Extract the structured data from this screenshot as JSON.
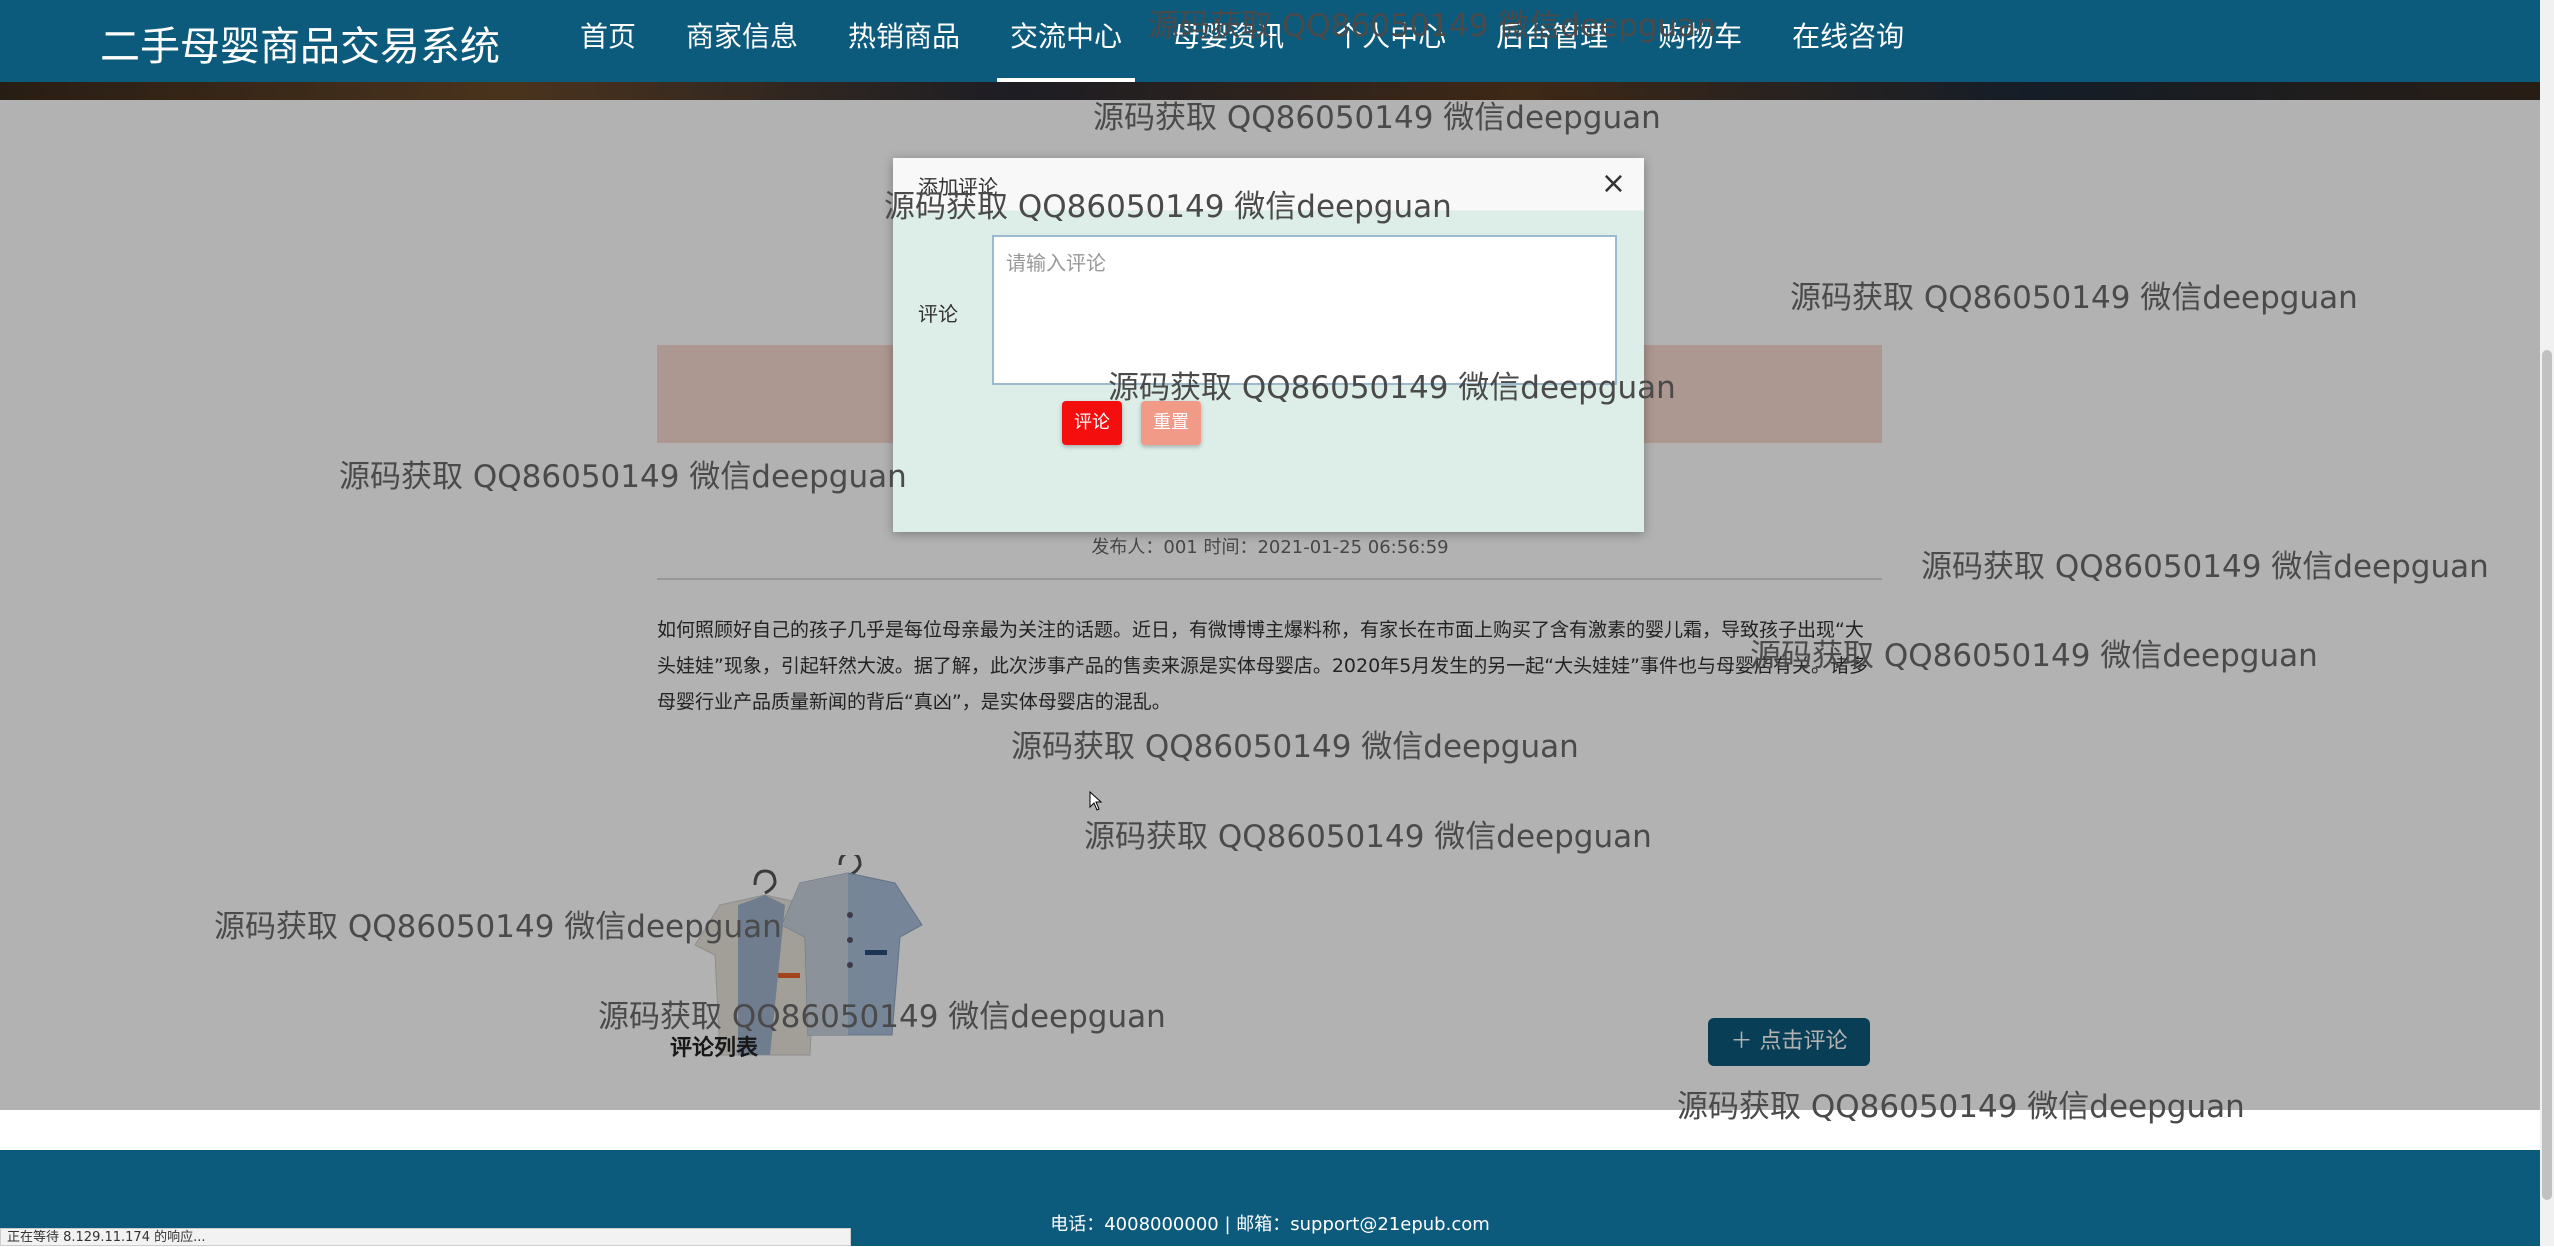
{
  "header": {
    "brand": "二手母婴商品交易系统",
    "nav": [
      {
        "label": "首页"
      },
      {
        "label": "商家信息"
      },
      {
        "label": "热销商品"
      },
      {
        "label": "交流中心"
      },
      {
        "label": "母婴资讯"
      },
      {
        "label": "个人中心"
      },
      {
        "label": "后台管理"
      },
      {
        "label": "购物车"
      },
      {
        "label": "在线咨询"
      }
    ],
    "active_nav": "交流中心"
  },
  "article": {
    "meta": "发布人：001 时间：2021-01-25 06:56:59",
    "body": "如何照顾好自己的孩子几乎是每位母亲最为关注的话题。近日，有微博博主爆料称，有家长在市面上购买了含有激素的婴儿霜，导致孩子出现“大头娃娃”现象，引起轩然大波。据了解，此次涉事产品的售卖来源是实体母婴店。2020年5月发生的另一起“大头娃娃”事件也与母婴店有关。诸多母婴行业产品质量新闻的背后“真凶”，是实体母婴店的混乱。",
    "comment_list_title": "评论列表",
    "add_comment_button": "＋ 点击评论"
  },
  "modal": {
    "title": "添加评论",
    "close": "×",
    "field_label": "评论",
    "input_placeholder": "请输入评论",
    "input_value": "",
    "submit": "评论",
    "reset": "重置"
  },
  "footer": {
    "text": "电话：4008000000 | 邮箱：support@21epub.com"
  },
  "watermark": "源码获取 QQ86050149 微信deepguan",
  "status_bar": "正在等待 8.129.11.174 的响应...",
  "colors": {
    "header_bg": "#0c5a7c",
    "submit_btn": "#f50e0e",
    "reset_btn": "#f19a88",
    "modal_bg": "#ddede7"
  }
}
